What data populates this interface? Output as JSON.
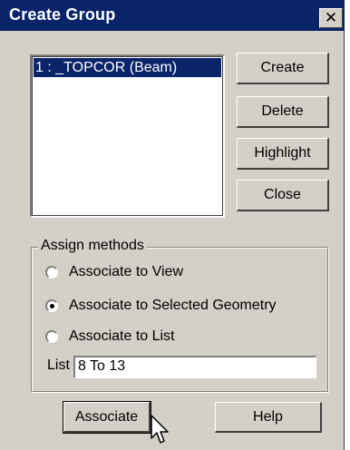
{
  "window": {
    "title": "Create Group",
    "close_glyph": "✕"
  },
  "group_list": {
    "items": [
      "1 : _TOPCOR (Beam)"
    ],
    "selected_index": 0
  },
  "buttons": {
    "create": "Create",
    "delete": "Delete",
    "highlight": "Highlight",
    "close": "Close",
    "associate": "Associate",
    "help": "Help"
  },
  "assign_methods": {
    "legend": "Assign methods",
    "options": [
      {
        "label": "Associate to View",
        "checked": false
      },
      {
        "label": "Associate to Selected Geometry",
        "checked": true
      },
      {
        "label": "Associate to List",
        "checked": false
      }
    ],
    "list_label": "List",
    "list_value": "8 To 13"
  },
  "icons": {
    "cursor": "arrow-cursor-icon"
  },
  "colors": {
    "title_bar": "#0a246a",
    "face": "#d4d0c8",
    "selection": "#0a246a"
  }
}
